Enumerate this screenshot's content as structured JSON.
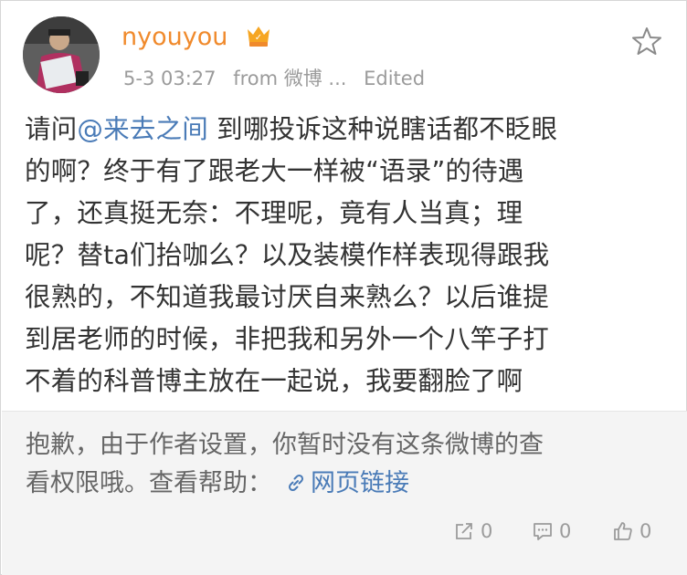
{
  "post": {
    "username": "nyouyou",
    "timestamp": "5-3 03:27",
    "source": "from 微博 ...",
    "edited_label": "Edited",
    "lines": [
      {
        "before": "请问",
        "mention": "@来去之间",
        "after": " 到哪投诉这种说瞎话都不眨眼"
      },
      {
        "text": "的啊？终于有了跟老大一样被“语录”的待遇"
      },
      {
        "text": "了，还真挺无奈：不理呢，竟有人当真；理"
      },
      {
        "text": "呢？替ta们抬咖么？以及装模作样表现得跟我"
      },
      {
        "text": "很熟的，不知道我最讨厌自来熟么？以后谁提"
      },
      {
        "text": "到居老师的时候，非把我和另外一个八竿子打"
      },
      {
        "text": "不着的科普博主放在一起说，我要翻脸了啊"
      }
    ]
  },
  "notice": {
    "line1": "抱歉，由于作者设置，你暂时没有这条微博的查",
    "line2_prefix": "看权限哦。查看帮助：",
    "link_label": "网页链接"
  },
  "actions": {
    "repost_count": "0",
    "comment_count": "0",
    "like_count": "0"
  },
  "icons": [
    "crown-icon",
    "star-icon",
    "link-icon",
    "repost-icon",
    "comment-icon",
    "like-icon"
  ],
  "colors": {
    "username": "#f08a2c",
    "link": "#4a7bb7",
    "notice_bg": "#f4f4f4",
    "meta": "#9b9b9b"
  }
}
